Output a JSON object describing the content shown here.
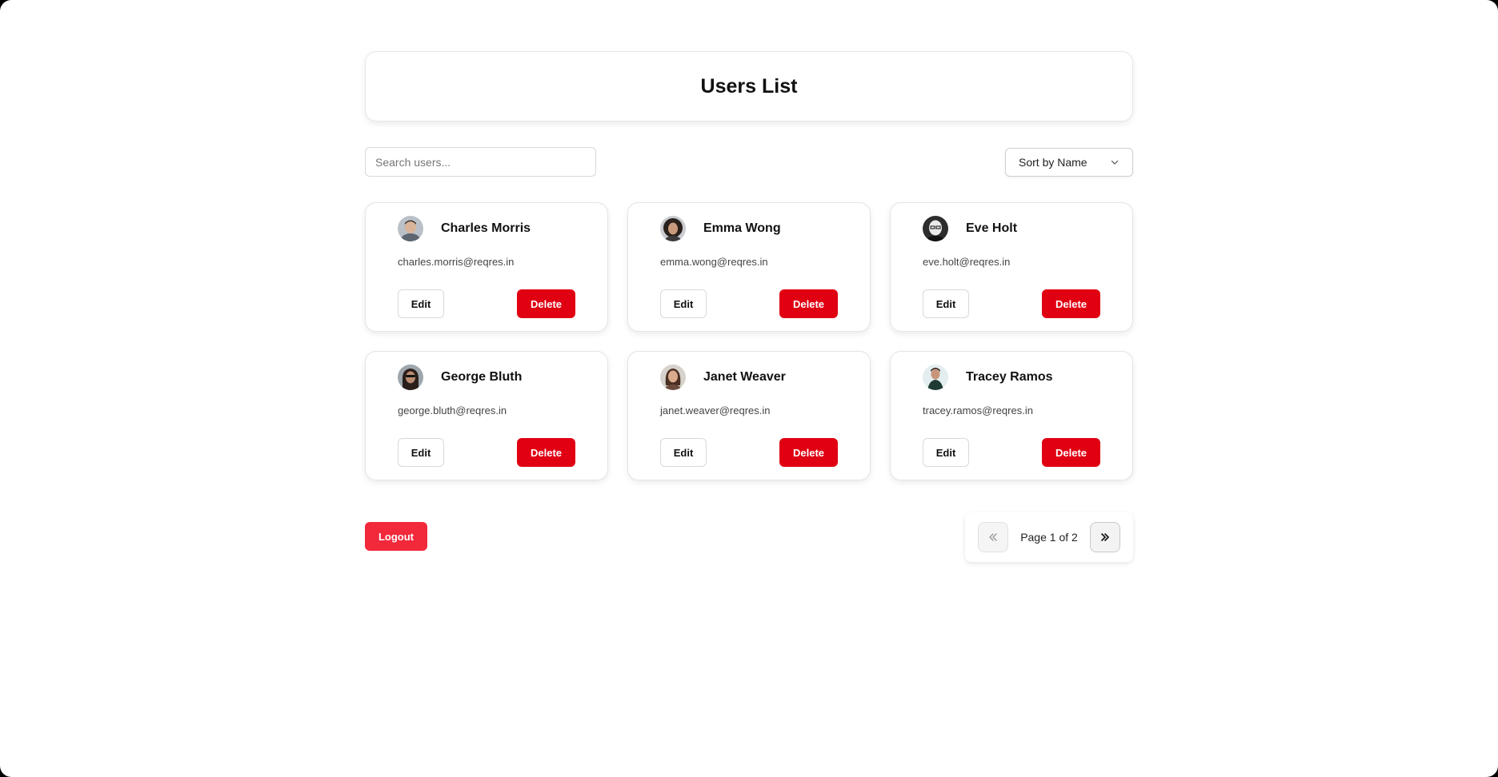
{
  "header": {
    "title": "Users List"
  },
  "toolbar": {
    "search_placeholder": "Search users...",
    "search_value": "",
    "sort_label": "Sort by Name"
  },
  "users": [
    {
      "name": "Charles Morris",
      "email": "charles.morris@reqres.in",
      "edit_label": "Edit",
      "delete_label": "Delete"
    },
    {
      "name": "Emma Wong",
      "email": "emma.wong@reqres.in",
      "edit_label": "Edit",
      "delete_label": "Delete"
    },
    {
      "name": "Eve Holt",
      "email": "eve.holt@reqres.in",
      "edit_label": "Edit",
      "delete_label": "Delete"
    },
    {
      "name": "George Bluth",
      "email": "george.bluth@reqres.in",
      "edit_label": "Edit",
      "delete_label": "Delete"
    },
    {
      "name": "Janet Weaver",
      "email": "janet.weaver@reqres.in",
      "edit_label": "Edit",
      "delete_label": "Delete"
    },
    {
      "name": "Tracey Ramos",
      "email": "tracey.ramos@reqres.in",
      "edit_label": "Edit",
      "delete_label": "Delete"
    }
  ],
  "footer": {
    "logout_label": "Logout",
    "page_text": "Page 1 of 2"
  },
  "colors": {
    "delete": "#e00012",
    "logout": "#f2283b"
  },
  "icons": {
    "sort": "chevron-down-icon",
    "prev": "double-chevron-left-icon",
    "next": "double-chevron-right-icon"
  }
}
